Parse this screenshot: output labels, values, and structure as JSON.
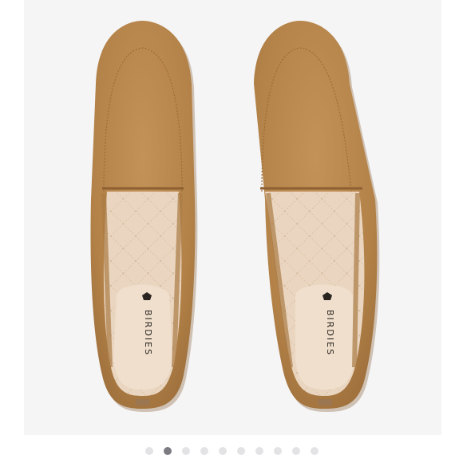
{
  "product_image": {
    "brand_label_left": "BIRDIES",
    "brand_label_right": "BIRDIES",
    "background_color": "#f5f5f6",
    "suede_color": "#b8874f",
    "insole_color": "#ead6c0"
  },
  "gallery": {
    "total_images": 10,
    "active_index": 1,
    "dot_color": "#e3e3e6",
    "active_dot_color": "#7b7b82"
  }
}
